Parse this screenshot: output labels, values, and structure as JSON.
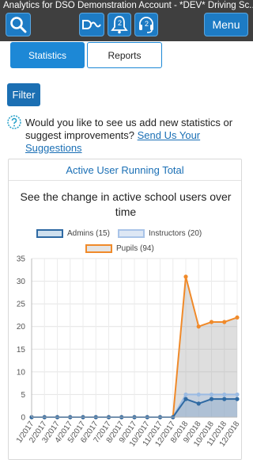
{
  "header": {
    "title": "Analytics for DSO Demonstration Account - *DEV* Driving Sc...",
    "notifications_count": "2",
    "support_count": "2",
    "menu_label": "Menu"
  },
  "tabs": [
    {
      "label": "Statistics",
      "active": true
    },
    {
      "label": "Reports",
      "active": false
    }
  ],
  "filter_label": "Filter",
  "suggestion": {
    "text": "Would you like to see us add new statistics or suggest improvements? ",
    "link": "Send Us Your Suggestions"
  },
  "card": {
    "title": "Active User Running Total",
    "chart_title": "See the change in active school users over time"
  },
  "colors": {
    "brand_blue": "#1d7bc4",
    "admins": "#2f6aa3",
    "instructors": "#9bbbe3",
    "pupils": "#f08a2a"
  },
  "legend": [
    {
      "label": "Admins (15)",
      "key": "admins"
    },
    {
      "label": "Instructors (20)",
      "key": "instructors"
    },
    {
      "label": "Pupils (94)",
      "key": "pupils"
    }
  ],
  "chart_data": {
    "type": "area",
    "categories": [
      "1/2017",
      "2/2017",
      "3/2017",
      "4/2017",
      "5/2017",
      "6/2017",
      "7/2017",
      "8/2017",
      "9/2017",
      "10/2017",
      "11/2017",
      "12/2017",
      "8/2018",
      "9/2018",
      "10/2018",
      "11/2018",
      "12/2018"
    ],
    "series": [
      {
        "name": "Admins (15)",
        "values": [
          0,
          0,
          0,
          0,
          0,
          0,
          0,
          0,
          0,
          0,
          0,
          0,
          4,
          3,
          4,
          4,
          4
        ]
      },
      {
        "name": "Instructors (20)",
        "values": [
          0,
          0,
          0,
          0,
          0,
          0,
          0,
          0,
          0,
          0,
          0,
          0,
          5,
          5,
          5,
          5,
          5
        ]
      },
      {
        "name": "Pupils (94)",
        "values": [
          0,
          0,
          0,
          0,
          0,
          0,
          0,
          0,
          0,
          0,
          0,
          0,
          31,
          20,
          21,
          21,
          22
        ]
      }
    ],
    "yticks": [
      0,
      5,
      10,
      15,
      20,
      25,
      30,
      35
    ],
    "ylim": [
      0,
      35
    ],
    "grid": true,
    "legend_position": "top"
  }
}
